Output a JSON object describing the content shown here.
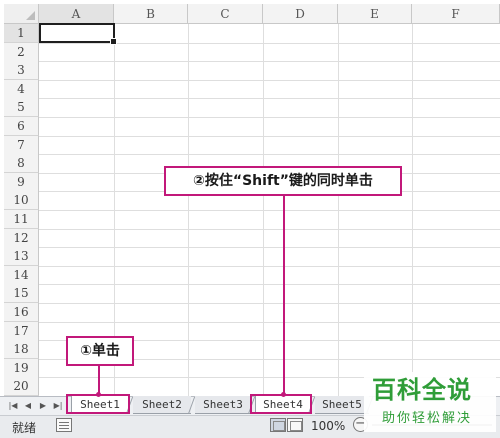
{
  "columns": [
    "A",
    "B",
    "C",
    "D",
    "E",
    "F"
  ],
  "rows": [
    "1",
    "2",
    "3",
    "4",
    "5",
    "6",
    "7",
    "8",
    "9",
    "10",
    "11",
    "12",
    "13",
    "14",
    "15",
    "16",
    "17",
    "18",
    "19",
    "20"
  ],
  "sheet_tabs": [
    "Sheet1",
    "Sheet2",
    "Sheet3",
    "Sheet4",
    "Sheet5"
  ],
  "status": {
    "ready": "就绪",
    "zoom": "100%",
    "zoom_minus": "−"
  },
  "annotations": {
    "shift_instruction": "②按住“Shift”键的同时单击",
    "click_instruction": "①单击"
  },
  "watermark": {
    "title": "百科全说",
    "subtitle": "助你轻松解决"
  },
  "colors": {
    "annotation": "#c2187a",
    "watermark": "#2f9d38"
  },
  "icons": {
    "nav": [
      "first-sheet-icon",
      "prev-sheet-icon",
      "next-sheet-icon",
      "last-sheet-icon"
    ]
  }
}
